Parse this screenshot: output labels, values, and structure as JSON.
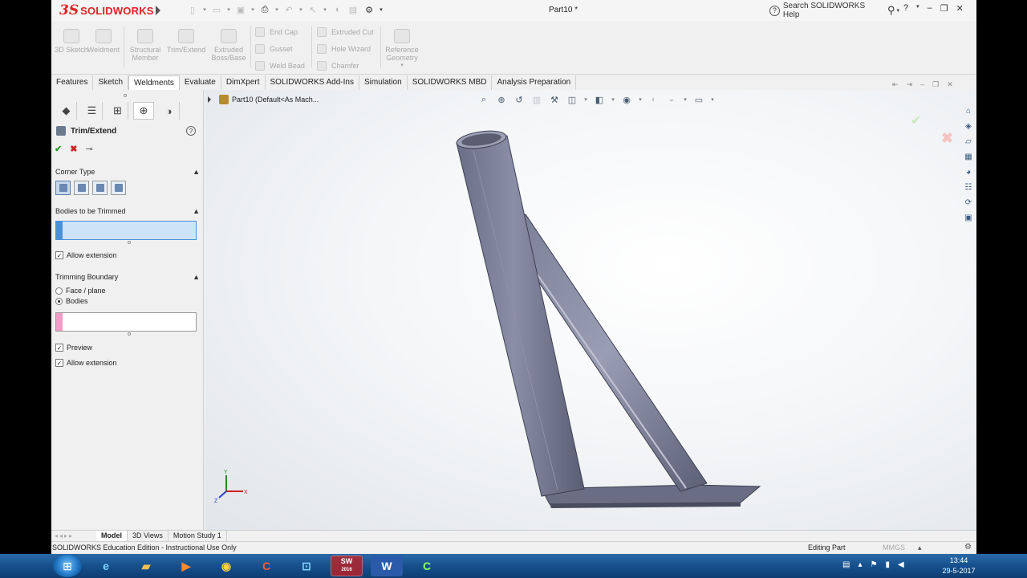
{
  "app": {
    "brand_ds": "3S",
    "brand_name": "SOLIDWORKS",
    "doc_title": "Part10 *",
    "search_placeholder": "Search SOLIDWORKS Help",
    "help": "?"
  },
  "ribbon": {
    "sketch3d": "3D Sketch",
    "weldment": "Weldment",
    "structural": "Structural Member",
    "trim": "Trim/Extend",
    "extruded_boss": "Extruded Boss/Base",
    "end_cap": "End Cap",
    "gusset": "Gusset",
    "weld_bead": "Weld Bead",
    "extruded_cut": "Extruded Cut",
    "hole_wizard": "Hole Wizard",
    "chamfer": "Chamfer",
    "reference_geometry": "Reference Geometry"
  },
  "tabs": [
    {
      "label": "Features"
    },
    {
      "label": "Sketch"
    },
    {
      "label": "Weldments"
    },
    {
      "label": "Evaluate"
    },
    {
      "label": "DimXpert"
    },
    {
      "label": "SOLIDWORKS Add-Ins"
    },
    {
      "label": "Simulation"
    },
    {
      "label": "SOLIDWORKS MBD"
    },
    {
      "label": "Analysis Preparation"
    }
  ],
  "panel": {
    "title": "Trim/Extend",
    "corner_type": "Corner Type",
    "bodies_trimmed": "Bodies to be Trimmed",
    "allow_extension": "Allow extension",
    "trimming_boundary": "Trimming Boundary",
    "face_plane": "Face / plane",
    "bodies": "Bodies",
    "preview": "Preview",
    "allow_extension2": "Allow extension"
  },
  "viewport": {
    "tree_label": "Part10  (Default<As Mach...",
    "triad_x": "X",
    "triad_y": "Y",
    "triad_z": "Z"
  },
  "bottom_tabs": [
    {
      "label": "Model"
    },
    {
      "label": "3D Views"
    },
    {
      "label": "Motion Study 1"
    }
  ],
  "status": {
    "edition": "SOLIDWORKS Education Edition - Instructional Use Only",
    "mode": "Editing Part",
    "units": "MMGS"
  },
  "taskbar": {
    "time": "13:44",
    "date": "29-5-2017",
    "sw_label": "SW",
    "sw_year": "2016"
  }
}
